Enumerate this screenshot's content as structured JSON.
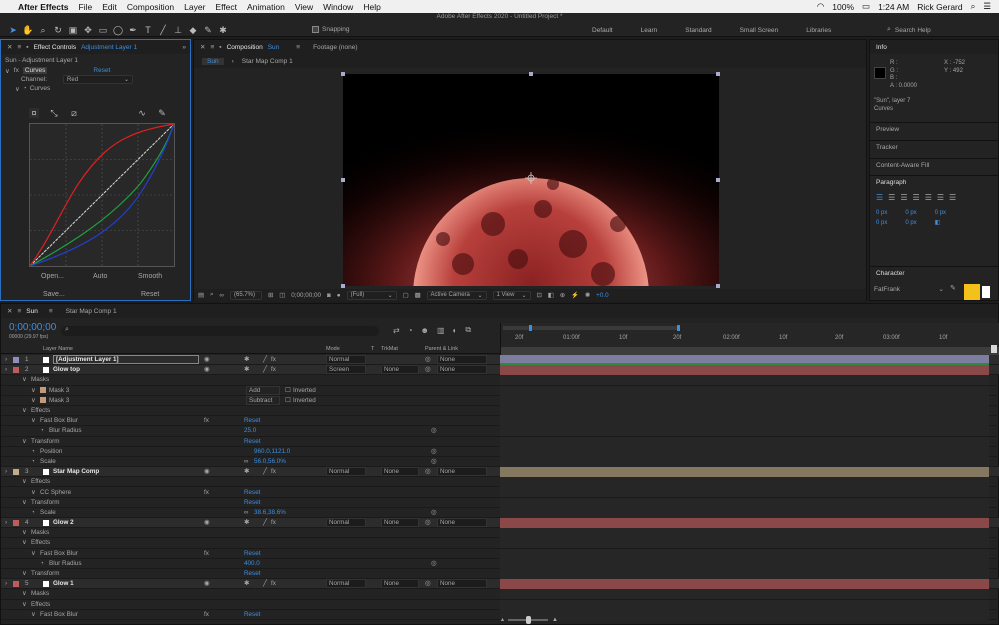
{
  "menubar": {
    "apple": "",
    "app": "After Effects",
    "items": [
      "File",
      "Edit",
      "Composition",
      "Layer",
      "Effect",
      "Animation",
      "View",
      "Window",
      "Help"
    ],
    "battery": "100%",
    "time": "1:24 AM",
    "user": "Rick Gerard"
  },
  "title": "Adobe After Effects 2020 - Untitled Project *",
  "toolbar": {
    "snapping": "Snapping",
    "workspaces": [
      "Default",
      "Learn",
      "Standard",
      "Small Screen",
      "Libraries"
    ],
    "search": "Search Help"
  },
  "effect_controls": {
    "tab_prefix": "Effect Controls",
    "tab_layer": "Adjustment Layer 1",
    "subtitle": "Sun - Adjustment Layer 1",
    "fx_label": "fx",
    "fx_name": "Curves",
    "reset": "Reset",
    "channel_label": "Channel:",
    "channel_value": "Red",
    "curves_label": "Curves",
    "open": "Open...",
    "auto": "Auto",
    "smooth": "Smooth",
    "save": "Save...",
    "reset2": "Reset"
  },
  "composition": {
    "tab_prefix": "Composition",
    "tab_name": "Sun",
    "footage": "Footage (none)",
    "crumb_sun": "Sun",
    "crumb_star": "Star Map Comp 1",
    "zoom": "(65.7%)",
    "timecode": "0;00;00;00",
    "resolution": "(Full)",
    "camera": "Active Camera",
    "view": "1 View",
    "exposure": "+0.0"
  },
  "info": {
    "title": "Info",
    "r": "R :",
    "g": "G :",
    "b": "B :",
    "a": "A : 0.0000",
    "x": "X : -752",
    "y": "Y : 492",
    "layer": "\"Sun\", layer 7",
    "effect": "Curves",
    "preview": "Preview",
    "tracker": "Tracker",
    "fill": "Content-Aware Fill",
    "paragraph": "Paragraph",
    "px_values": [
      "0 px",
      "0 px",
      "0 px",
      "0 px",
      "0 px"
    ],
    "character": "Character",
    "font": "FatFrank"
  },
  "timeline": {
    "tab_sun": "Sun",
    "tab_star": "Star Map Comp 1",
    "timecode": "0;00;00;00",
    "fps": "00000 (29.97 fps)",
    "col_layer": "Layer Name",
    "col_mode": "Mode",
    "col_t": "T",
    "col_trkmat": "TrkMat",
    "col_parent": "Parent & Link",
    "ruler": [
      "20f",
      "01:00f",
      "10f",
      "20f",
      "02:00f",
      "10f",
      "20f",
      "03:00f",
      "10f"
    ],
    "rows": [
      {
        "num": "1",
        "name": "[Adjustment Layer 1]",
        "mode": "Normal",
        "trk": "",
        "parent": "None",
        "type": "layer",
        "color": "#8f8fbf",
        "bar": "#7d7d9f"
      },
      {
        "num": "2",
        "name": "Glow top",
        "mode": "Screen",
        "trk": "None",
        "parent": "None",
        "type": "layer",
        "color": "#c15a5a",
        "bar": "#8b4848"
      },
      {
        "name": "Masks",
        "type": "group",
        "indent": 1
      },
      {
        "name": "Mask 3",
        "type": "mask",
        "mode": "Add",
        "inv": "Inverted",
        "color": "#c49a7b",
        "indent": 2
      },
      {
        "name": "Mask 3",
        "type": "mask",
        "mode": "Subtract",
        "inv": "Inverted",
        "color": "#c49a7b",
        "indent": 2
      },
      {
        "name": "Effects",
        "type": "group",
        "indent": 1
      },
      {
        "name": "Fast Box Blur",
        "type": "effect",
        "val": "Reset",
        "indent": 2
      },
      {
        "name": "Blur Radius",
        "type": "prop",
        "val": "25.0",
        "indent": 3
      },
      {
        "name": "Transform",
        "type": "group",
        "val": "Reset",
        "indent": 1
      },
      {
        "name": "Position",
        "type": "prop",
        "val": "960.0,1121.0",
        "indent": 2
      },
      {
        "name": "Scale",
        "type": "prop",
        "val": "56.0,56.0%",
        "indent": 2
      },
      {
        "num": "3",
        "name": "Star Map Comp",
        "mode": "Normal",
        "trk": "None",
        "parent": "None",
        "type": "layer",
        "color": "#c4ab8a",
        "bar": "#857860"
      },
      {
        "name": "Effects",
        "type": "group",
        "indent": 1
      },
      {
        "name": "CC Sphere",
        "type": "effect",
        "val": "Reset",
        "indent": 2
      },
      {
        "name": "Transform",
        "type": "group",
        "val": "Reset",
        "indent": 1
      },
      {
        "name": "Scale",
        "type": "prop",
        "val": "38.6,38.6%",
        "indent": 2
      },
      {
        "num": "4",
        "name": "Glow 2",
        "mode": "Normal",
        "trk": "None",
        "parent": "None",
        "type": "layer",
        "color": "#c15a5a",
        "bar": "#8b4848"
      },
      {
        "name": "Masks",
        "type": "group",
        "indent": 1
      },
      {
        "name": "Effects",
        "type": "group",
        "indent": 1
      },
      {
        "name": "Fast Box Blur",
        "type": "effect",
        "val": "Reset",
        "indent": 2
      },
      {
        "name": "Blur Radius",
        "type": "prop",
        "val": "400.0",
        "indent": 3
      },
      {
        "name": "Transform",
        "type": "group",
        "val": "Reset",
        "indent": 1
      },
      {
        "num": "5",
        "name": "Glow 1",
        "mode": "Normal",
        "trk": "None",
        "parent": "None",
        "type": "layer",
        "color": "#c15a5a",
        "bar": "#8b4848"
      },
      {
        "name": "Masks",
        "type": "group",
        "indent": 1
      },
      {
        "name": "Effects",
        "type": "group",
        "indent": 1
      },
      {
        "name": "Fast Box Blur",
        "type": "effect",
        "val": "Reset",
        "indent": 2
      }
    ]
  },
  "colors": {
    "accent": "#3d8fe0",
    "sun": "#d8605a",
    "glow_bar": "#8b4848",
    "character_swatch": "#f2c21b"
  }
}
